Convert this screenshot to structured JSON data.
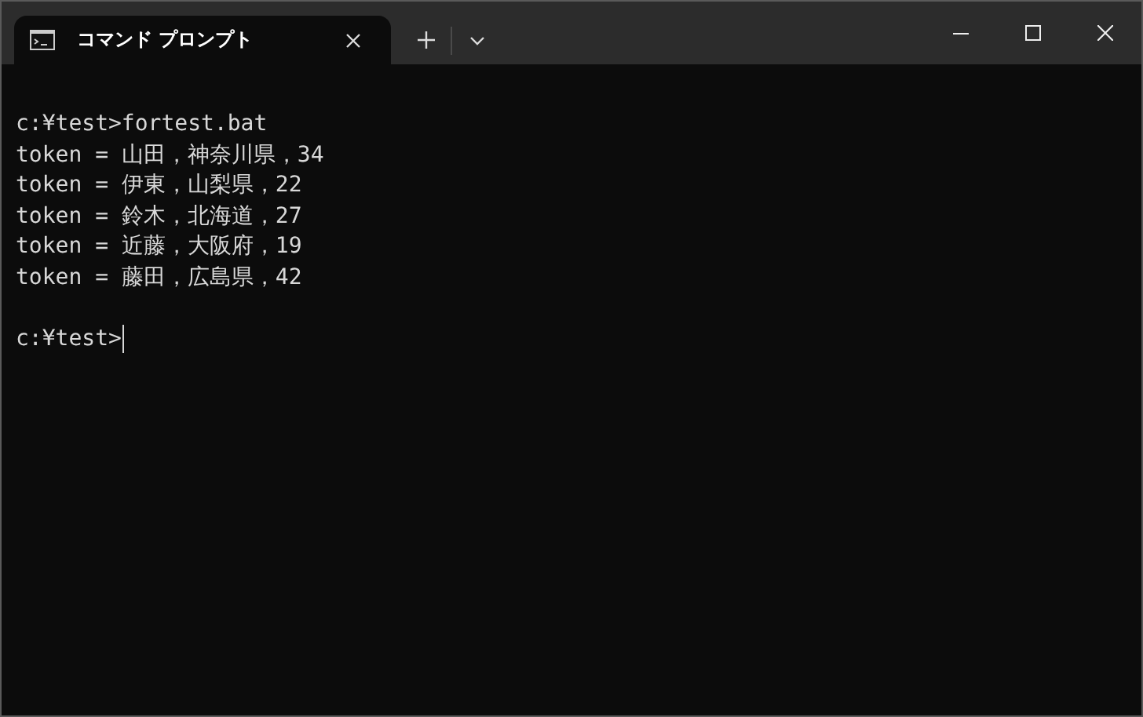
{
  "tab": {
    "title": "コマンド プロンプト",
    "selected": true
  },
  "terminal": {
    "lines": [
      "c:¥test>fortest.bat",
      "token = 山田，神奈川県，34",
      "token = 伊東，山梨県，22",
      "token = 鈴木，北海道，27",
      "token = 近藤，大阪府，19",
      "token = 藤田，広島県，42"
    ],
    "prompt": "c:¥test>"
  }
}
